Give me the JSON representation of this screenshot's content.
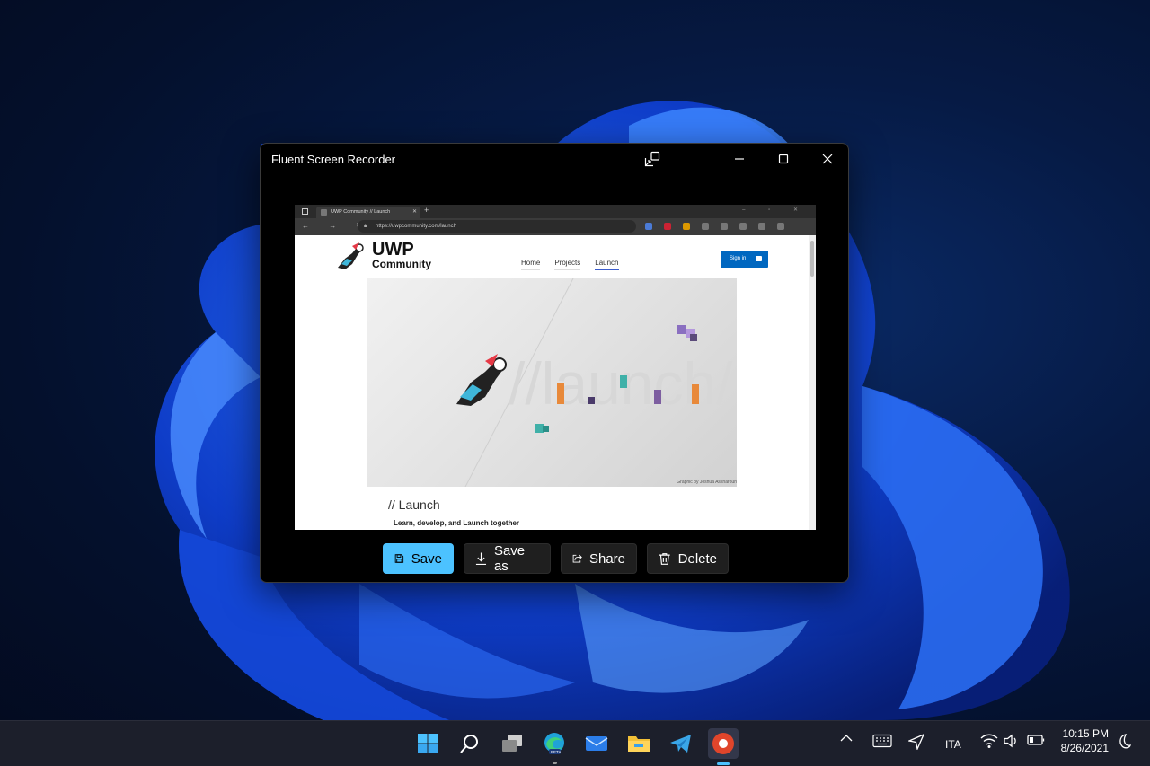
{
  "window": {
    "title": "Fluent Screen Recorder"
  },
  "browser": {
    "tab_title": "UWP Community // Launch",
    "url": "https://uwpcommunity.com/launch"
  },
  "site": {
    "logo_line1": "UWP",
    "logo_line2": "Community",
    "nav": [
      "Home",
      "Projects",
      "Launch"
    ],
    "active_nav": "Launch",
    "signin_label": "Sign in",
    "banner_text": "//launch/",
    "banner_credit": "Graphic by Joshua Askharoun",
    "heading": "// Launch",
    "subheading": "Learn, develop, and Launch together"
  },
  "actions": {
    "save": "Save",
    "save_as": "Save as",
    "share": "Share",
    "delete": "Delete"
  },
  "taskbar": {
    "apps": [
      "start-icon",
      "search-icon",
      "task-view-icon",
      "edge-beta-icon",
      "mail-icon",
      "file-explorer-icon",
      "telegram-icon",
      "screen-recorder-icon"
    ],
    "language": "ITA",
    "time": "10:15 PM",
    "date": "8/26/2021"
  },
  "colors": {
    "accent": "#4cc2ff",
    "signin": "#0067c0"
  }
}
